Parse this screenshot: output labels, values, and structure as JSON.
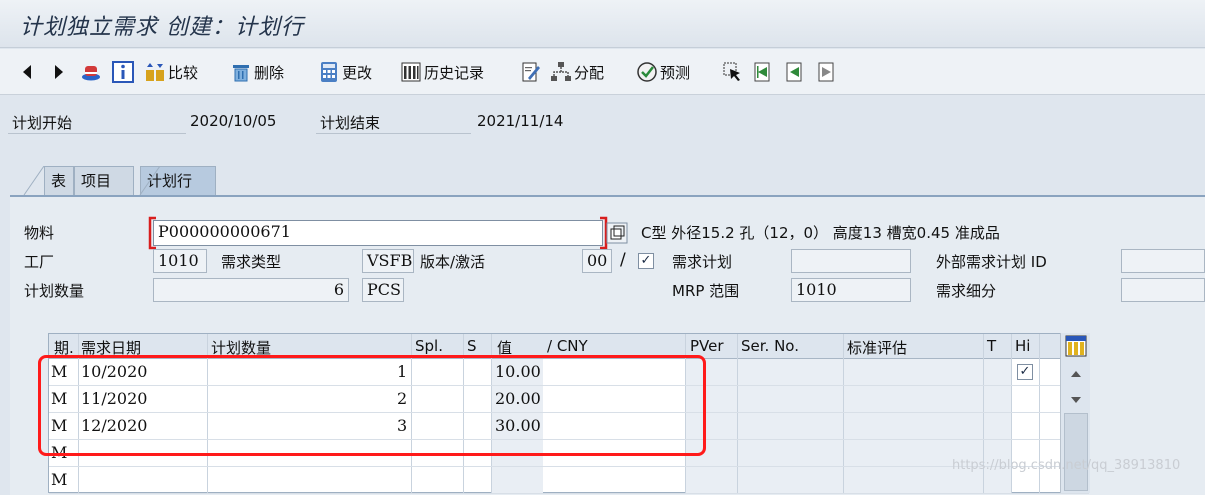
{
  "title": "计划独立需求 创建：计划行",
  "toolbar": {
    "compare": "比较",
    "delete": "删除",
    "change": "更改",
    "history": "历史记录",
    "assign": "分配",
    "forecast": "预测"
  },
  "header": {
    "plan_start_label": "计划开始",
    "plan_start_value": "2020/10/05",
    "plan_end_label": "计划结束",
    "plan_end_value": "2021/11/14"
  },
  "tabs": [
    "表",
    "项目",
    "计划行"
  ],
  "fields": {
    "material_label": "物料",
    "material_value": "P000000000671",
    "material_desc": "C型 外径15.2 孔（12，0） 高度13 槽宽0.45 准成品",
    "plant_label": "工厂",
    "plant_value": "1010",
    "req_type_label": "需求类型",
    "req_type_value": "VSFB",
    "version_label": "版本/激活",
    "version_value": "00",
    "req_plan_label": "需求计划",
    "ext_req_id_label": "外部需求计划 ID",
    "plan_qty_label": "计划数量",
    "plan_qty_value": "6",
    "unit_value": "PCS",
    "mrp_area_label": "MRP 范围",
    "mrp_area_value": "1010",
    "req_detail_label": "需求细分"
  },
  "table": {
    "columns": [
      "期.",
      "需求日期",
      "计划数量",
      "Spl.",
      "S",
      "值",
      "/ CNY",
      "PVer",
      "Ser. No.",
      "标准评估",
      "T",
      "Hi"
    ],
    "rows": [
      {
        "period": "M",
        "date": "10/2020",
        "qty": "1",
        "value": "10.00"
      },
      {
        "period": "M",
        "date": "11/2020",
        "qty": "2",
        "value": "20.00"
      },
      {
        "period": "M",
        "date": "12/2020",
        "qty": "3",
        "value": "30.00"
      },
      {
        "period": "M",
        "date": "",
        "qty": "",
        "value": ""
      },
      {
        "period": "M",
        "date": "",
        "qty": "",
        "value": ""
      }
    ]
  },
  "watermark": "https://blog.csdn.net/qq_38913810"
}
